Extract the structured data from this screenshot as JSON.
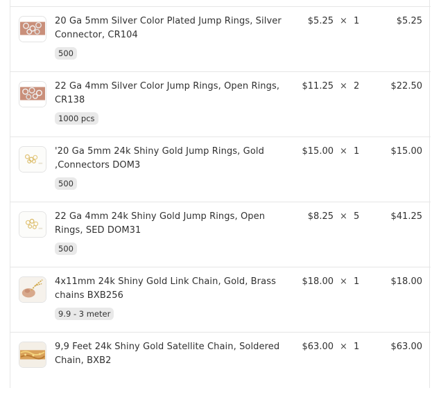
{
  "order": {
    "times_symbol": "×",
    "items": [
      {
        "title": "20 Ga 5mm Silver Color Plated Jump Rings, Silver Connector, CR104",
        "variant": "500",
        "unit_price": "$5.25",
        "quantity": "1",
        "total": "$5.25",
        "thumb_icon": "silver-jump-rings-thumbnail"
      },
      {
        "title": "22 Ga 4mm Silver Color Jump Rings, Open Rings, CR138",
        "variant": "1000 pcs",
        "unit_price": "$11.25",
        "quantity": "2",
        "total": "$22.50",
        "thumb_icon": "silver-jump-rings-thumbnail"
      },
      {
        "title": "'20 Ga 5mm 24k Shiny Gold Jump Rings, Gold ,Connectors DOM3",
        "variant": "500",
        "unit_price": "$15.00",
        "quantity": "1",
        "total": "$15.00",
        "thumb_icon": "gold-jump-rings-thumbnail"
      },
      {
        "title": "22 Ga 4mm 24k Shiny Gold Jump Rings, Open Rings, SED DOM31",
        "variant": "500",
        "unit_price": "$8.25",
        "quantity": "5",
        "total": "$41.25",
        "thumb_icon": "gold-jump-rings-thumbnail"
      },
      {
        "title": "4x11mm 24k Shiny Gold Link Chain, Gold, Brass chains BXB256",
        "variant": "9.9 - 3 meter",
        "unit_price": "$18.00",
        "quantity": "1",
        "total": "$18.00",
        "thumb_icon": "gold-link-chain-thumbnail"
      },
      {
        "title": "9,9 Feet 24k Shiny Gold Satellite Chain, Soldered Chain, BXB2",
        "variant": "",
        "unit_price": "$63.00",
        "quantity": "1",
        "total": "$63.00",
        "thumb_icon": "gold-satellite-chain-thumbnail"
      }
    ]
  }
}
